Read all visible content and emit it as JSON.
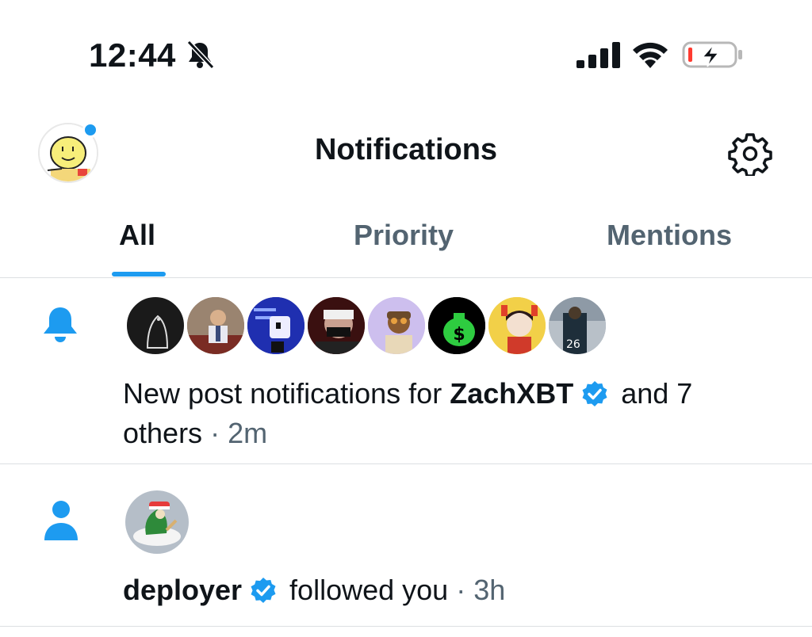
{
  "status_bar": {
    "time": "12:44",
    "icons": [
      "bell-slash-icon",
      "cellular-signal-icon",
      "wifi-icon",
      "battery-charging-icon"
    ]
  },
  "header": {
    "title": "Notifications",
    "avatar_icon": "profile-avatar",
    "settings_icon": "gear-icon"
  },
  "tabs": [
    {
      "label": "All",
      "active": true
    },
    {
      "label": "Priority",
      "active": false
    },
    {
      "label": "Mentions",
      "active": false
    }
  ],
  "notifications": [
    {
      "icon": "bell-icon",
      "text_prefix": "New post notifications for ",
      "user": "ZachXBT",
      "text_suffix": " and 7",
      "text_line2": "others",
      "separator": " · ",
      "time": "2m",
      "avatar_count": 8
    },
    {
      "icon": "person-icon",
      "user": "deployer",
      "text": " followed you",
      "separator": " · ",
      "time": "3h"
    }
  ],
  "colors": {
    "accent": "#1d9bf0",
    "text_primary": "#0f1419",
    "text_secondary": "#536471",
    "divider": "#dcdfe2",
    "battery_low": "#ff3b30"
  }
}
